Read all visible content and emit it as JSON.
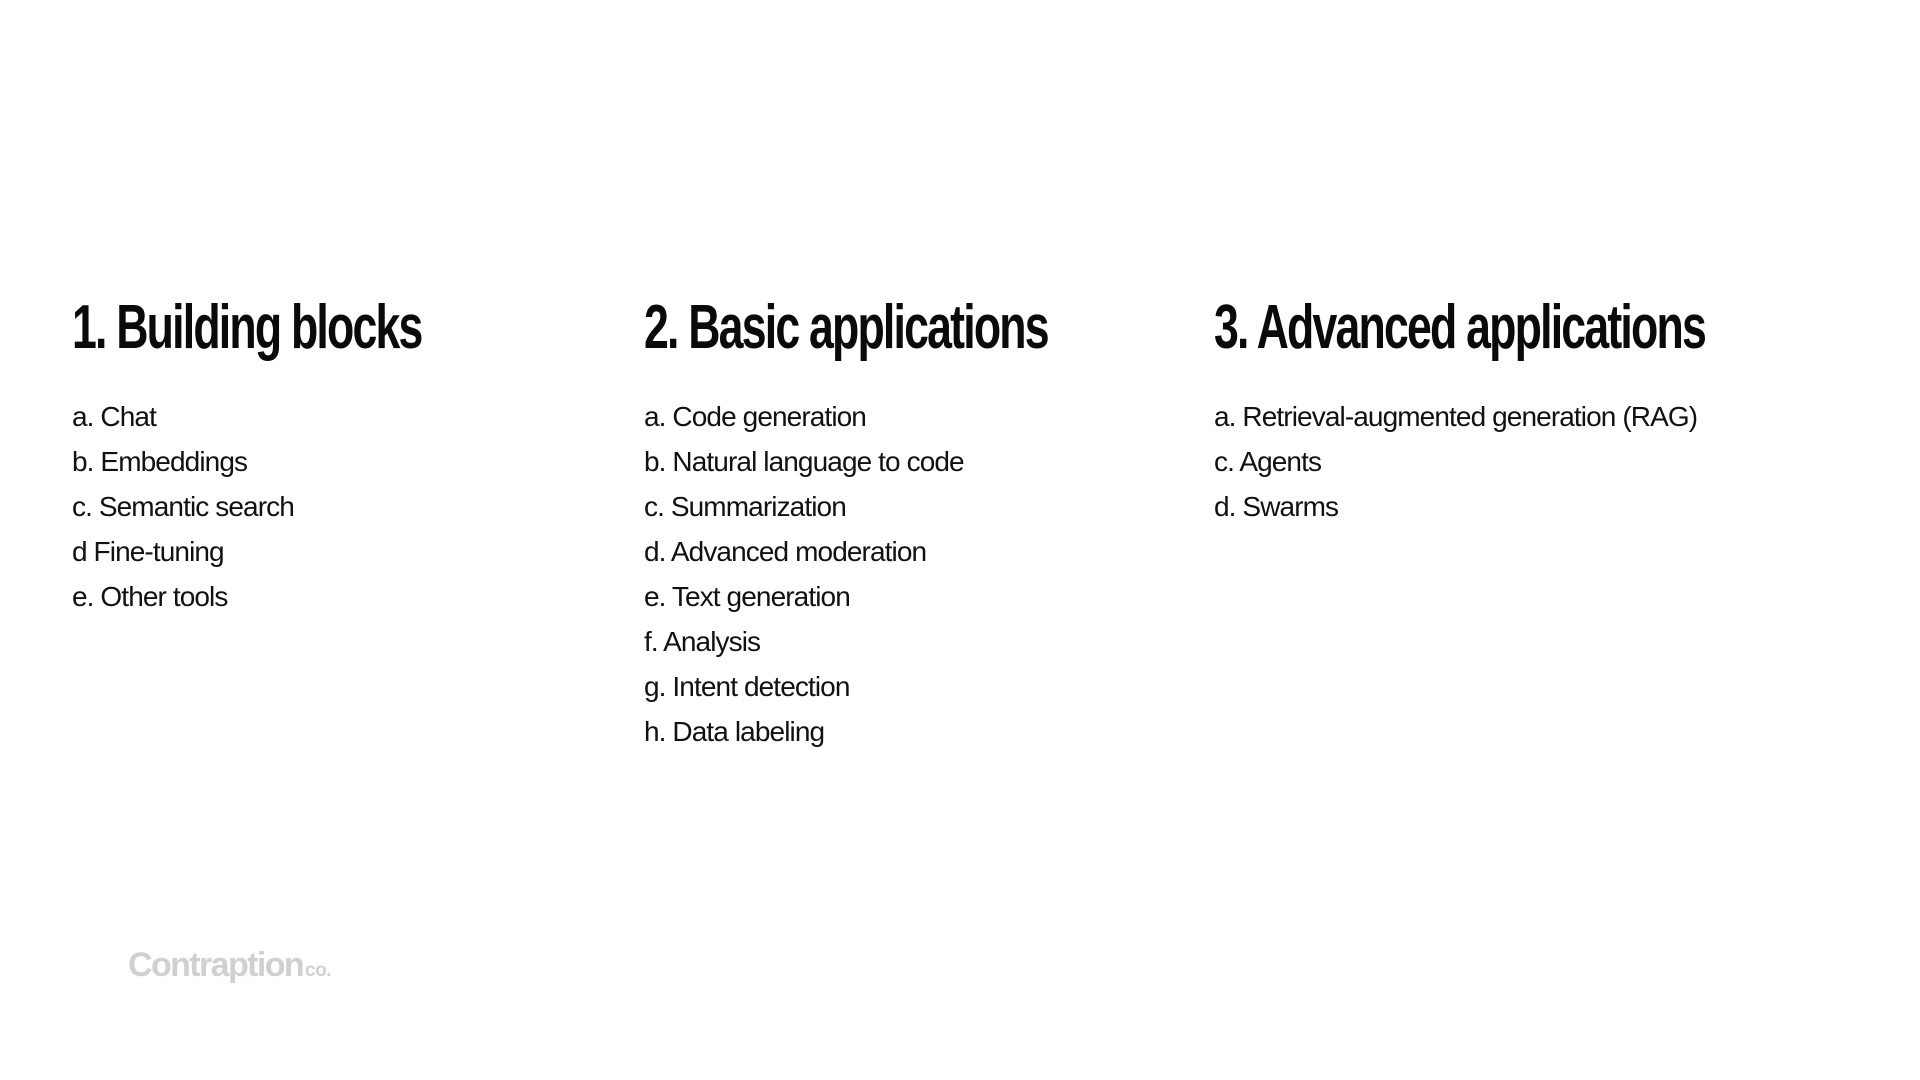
{
  "columns": [
    {
      "heading": "1. Building blocks",
      "items": [
        "a. Chat",
        "b. Embeddings",
        "c. Semantic search",
        "d Fine-tuning",
        "e. Other tools"
      ]
    },
    {
      "heading": "2. Basic applications",
      "items": [
        "a. Code generation",
        "b. Natural language to code",
        "c. Summarization",
        "d. Advanced moderation",
        "e. Text generation",
        "f. Analysis",
        "g. Intent detection",
        "h. Data labeling"
      ]
    },
    {
      "heading": "3. Advanced applications",
      "items": [
        "a. Retrieval-augmented generation (RAG)",
        "c. Agents",
        "d. Swarms"
      ]
    }
  ],
  "logo": {
    "main": "Contraption",
    "suffix": "co."
  },
  "colors": {
    "text": "#0a0a0a",
    "logo": "#d0d0d0",
    "background": "#ffffff"
  }
}
